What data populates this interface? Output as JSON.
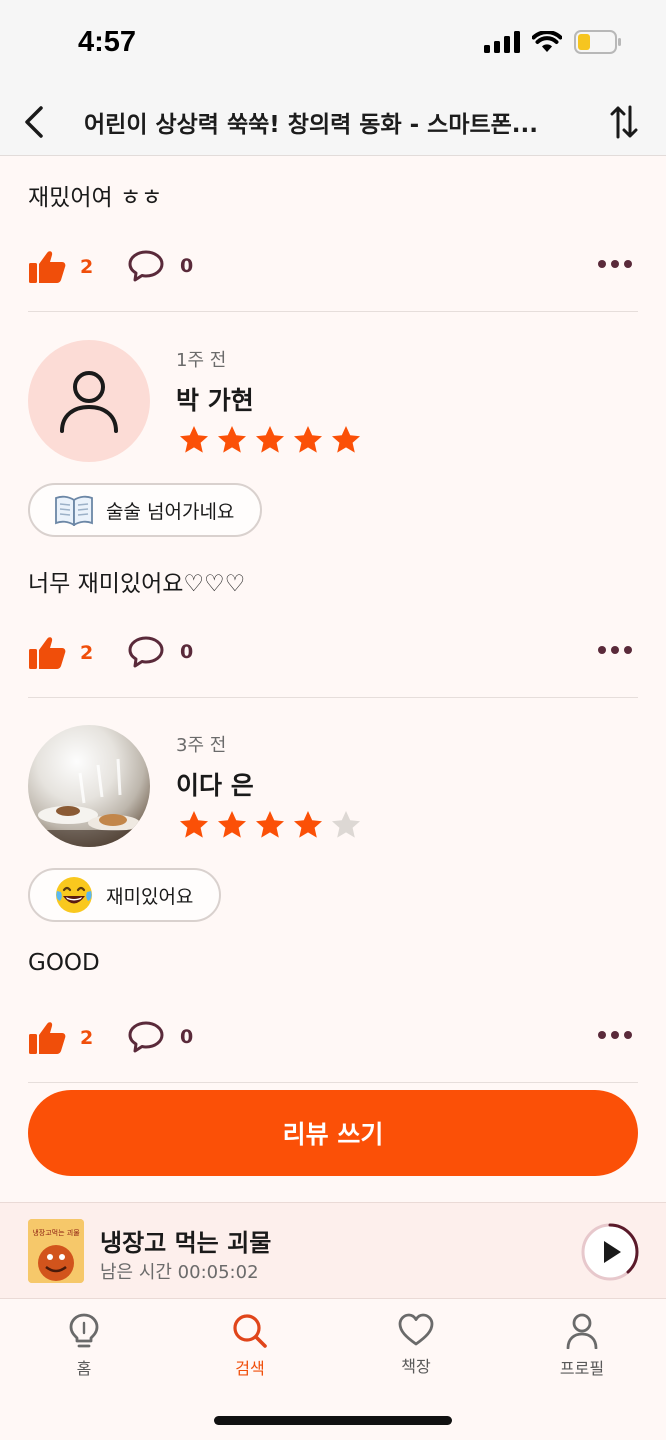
{
  "status_bar": {
    "time": "4:57"
  },
  "header": {
    "title": "어린이 상상력 쑥쑥! 창의력 동화 - 스마트폰..."
  },
  "reviews": [
    {
      "text": "재밌어여 ㅎㅎ",
      "likes": "2",
      "comments": "0"
    },
    {
      "time": "1주 전",
      "name": "박 가현",
      "rating": 5,
      "tag": "술술 넘어가네요",
      "tag_icon": "open-book-icon",
      "text": "너무 재미있어요♡♡♡",
      "likes": "2",
      "comments": "0"
    },
    {
      "time": "3주 전",
      "name": "이다 은",
      "rating": 4,
      "tag": "재미있어요",
      "tag_icon": "laughing-face-icon",
      "text": "GOOD",
      "likes": "2",
      "comments": "0"
    }
  ],
  "write_button": {
    "label": "리뷰 쓰기"
  },
  "mini_player": {
    "title": "냉장고 먹는 괴물",
    "remaining": "남은 시간 00:05:02",
    "cover_text": "냉장고먹는 괴물"
  },
  "tabs": [
    {
      "label": "홈",
      "icon": "lightbulb-icon"
    },
    {
      "label": "검색",
      "icon": "search-icon"
    },
    {
      "label": "책장",
      "icon": "heart-icon"
    },
    {
      "label": "프로필",
      "icon": "person-icon"
    }
  ],
  "colors": {
    "accent": "#fb5007",
    "star_off": "#ddd8d4",
    "icon_dark": "#5a2a3a"
  }
}
